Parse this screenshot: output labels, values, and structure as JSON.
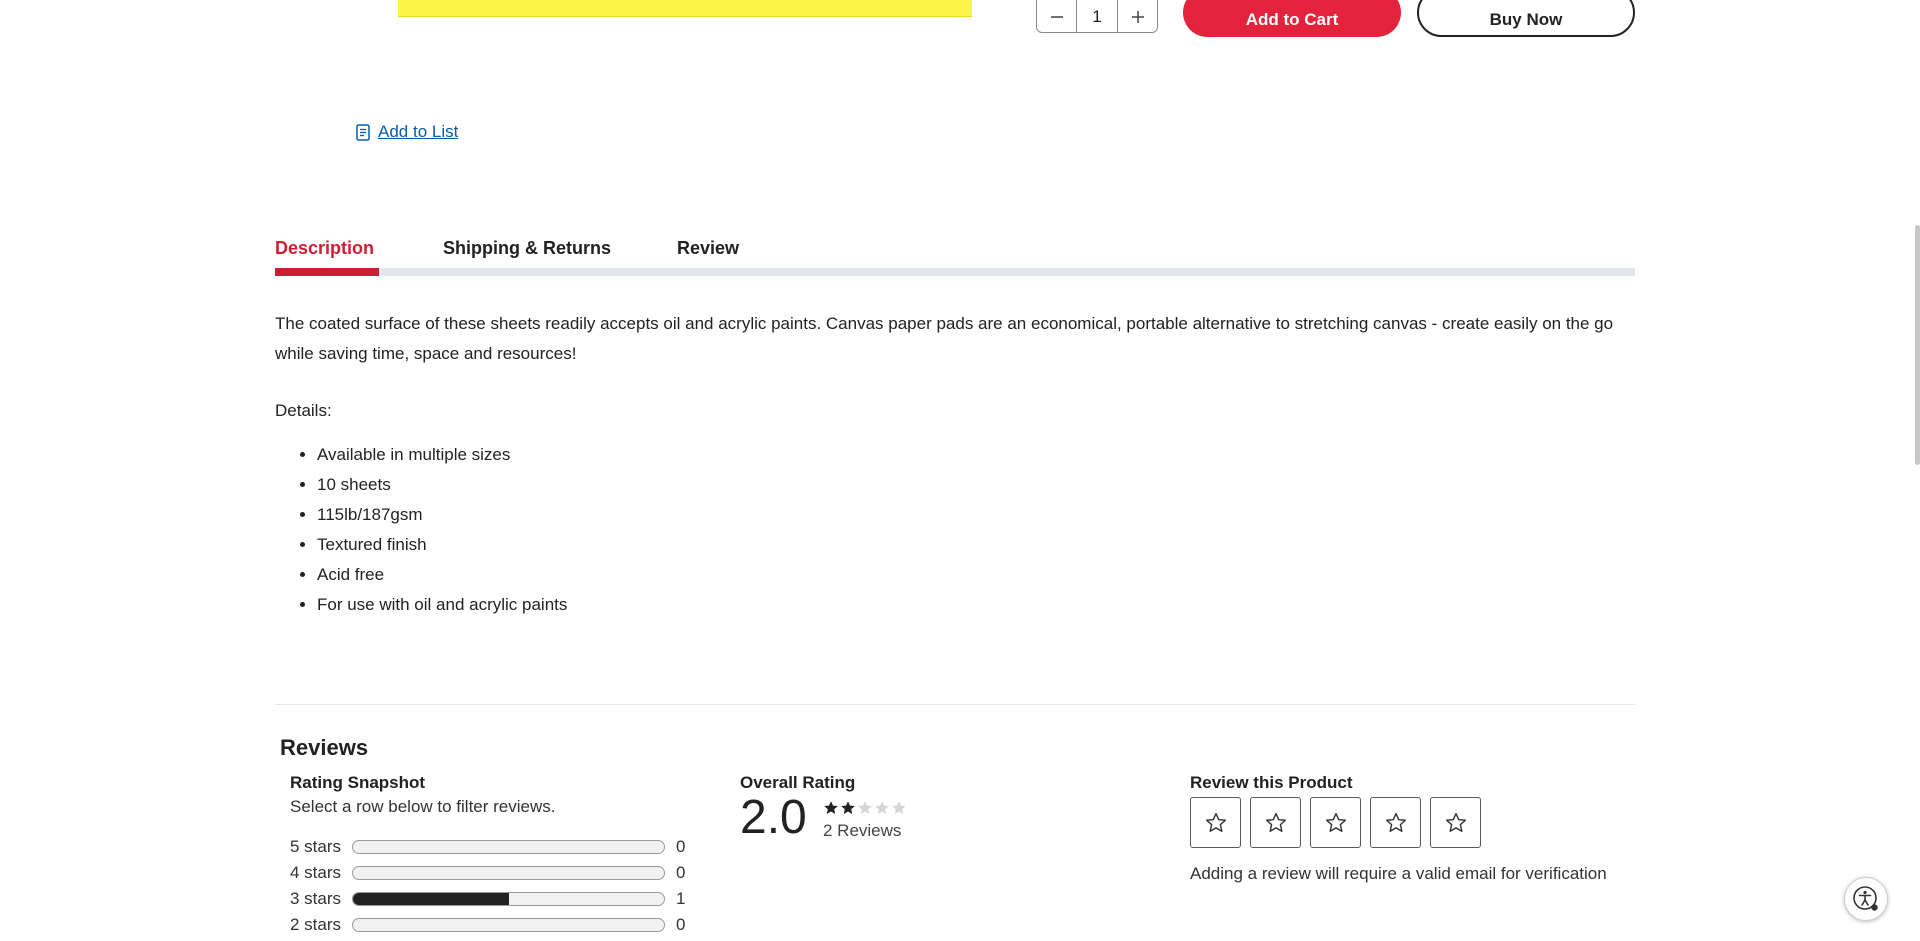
{
  "purchase": {
    "quantity": "1",
    "add_to_cart_label": "Add to Cart",
    "buy_now_label": "Buy Now",
    "add_to_list_label": "Add to List"
  },
  "tabs": [
    {
      "label": "Description",
      "active": true
    },
    {
      "label": "Shipping & Returns",
      "active": false
    },
    {
      "label": "Review",
      "active": false
    }
  ],
  "description": {
    "text": "The coated surface of these sheets readily accepts oil and acrylic paints. Canvas paper pads are an economical, portable alternative to stretching canvas - create easily on the go while saving time, space and resources!",
    "details_label": "Details:",
    "bullets": [
      "Available in multiple sizes",
      "10 sheets",
      "115lb/187gsm",
      "Textured finish",
      "Acid free",
      "For use with oil and acrylic paints"
    ]
  },
  "reviews": {
    "title": "Reviews",
    "snapshot": {
      "title": "Rating Snapshot",
      "subtitle": "Select a row below to filter reviews.",
      "rows": [
        {
          "label": "5 stars",
          "count": "0",
          "fraction": 0
        },
        {
          "label": "4 stars",
          "count": "0",
          "fraction": 0
        },
        {
          "label": "3 stars",
          "count": "1",
          "fraction": 0.5
        },
        {
          "label": "2 stars",
          "count": "0",
          "fraction": 0
        }
      ]
    },
    "overall": {
      "title": "Overall Rating",
      "score": "2.0",
      "stars_filled": 2,
      "stars_total": 5,
      "count_label": "2 Reviews"
    },
    "review_product": {
      "title": "Review this Product",
      "star_count": 5,
      "note": "Adding a review will require a valid email for verification"
    }
  },
  "colors": {
    "accent_red": "#e2233b",
    "tab_active": "#cc1f33",
    "link_blue": "#0a5aa8",
    "product_yellow": "#fbf54a"
  },
  "icons": {
    "qty_minus": "minus-icon",
    "qty_plus": "plus-icon",
    "list": "list-document-icon",
    "star": "star-icon",
    "accessibility": "accessibility-icon"
  }
}
